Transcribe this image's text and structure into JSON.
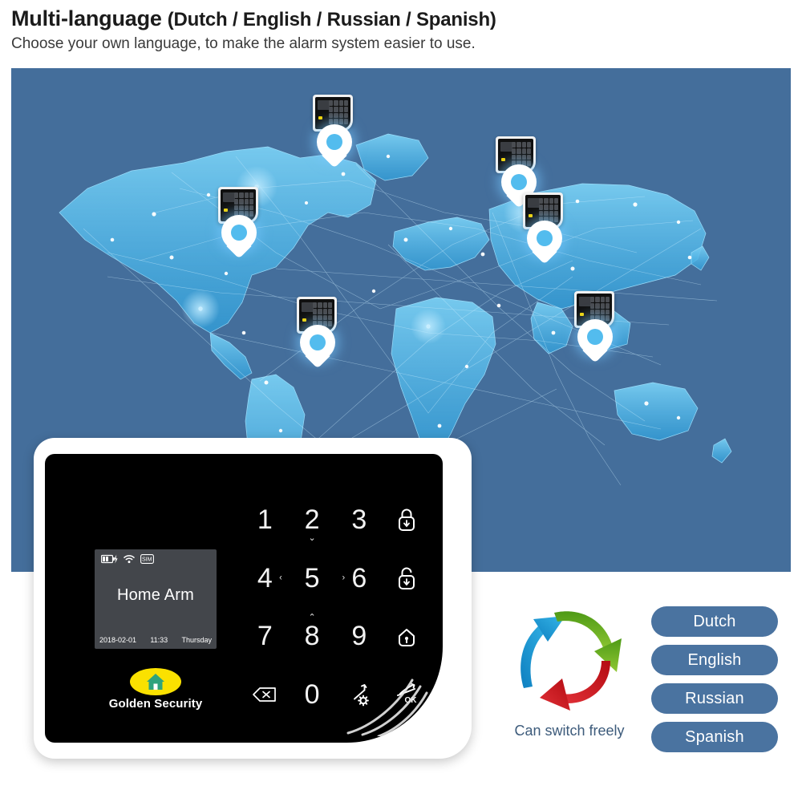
{
  "header": {
    "title_main": "Multi-language",
    "title_langs": "(Dutch / English / Russian / Spanish)",
    "subtitle": "Choose your own language, to make the alarm system easier to use."
  },
  "map": {
    "background_color": "#446E9B",
    "map_color": "#53BCEE",
    "pin_count": 6,
    "device_marker_count": 6
  },
  "device": {
    "lcd": {
      "main_text": "Home Arm",
      "date": "2018-02-01",
      "time": "11:33",
      "weekday": "Thursday",
      "status_icons": [
        "battery-charging-icon",
        "wifi-icon",
        "sim-icon"
      ]
    },
    "brand": {
      "name": "Golden Security",
      "badge_color": "#FAE100",
      "house_color": "#2FA37C"
    },
    "keypad": {
      "keys": [
        {
          "label": "1",
          "nav": "",
          "type": "digit"
        },
        {
          "label": "2",
          "nav": "v",
          "type": "digit"
        },
        {
          "label": "3",
          "nav": "",
          "type": "digit"
        },
        {
          "label": "",
          "nav": "",
          "type": "icon",
          "icon": "lock-closed-arm-icon"
        },
        {
          "label": "4",
          "nav": "<",
          "type": "digit"
        },
        {
          "label": "5",
          "nav": "",
          "type": "digit"
        },
        {
          "label": "6",
          "nav": ">",
          "type": "digit"
        },
        {
          "label": "",
          "nav": "",
          "type": "icon",
          "icon": "lock-open-disarm-icon"
        },
        {
          "label": "7",
          "nav": "",
          "type": "digit"
        },
        {
          "label": "8",
          "nav": "^",
          "type": "digit"
        },
        {
          "label": "9",
          "nav": "",
          "type": "digit"
        },
        {
          "label": "",
          "nav": "",
          "type": "icon",
          "icon": "home-arm-icon"
        },
        {
          "label": "",
          "nav": "",
          "type": "icon",
          "icon": "backspace-delete-icon"
        },
        {
          "label": "0",
          "nav": "",
          "type": "digit"
        },
        {
          "label": "",
          "nav": "",
          "type": "icon",
          "icon": "settings-gear-icon"
        },
        {
          "label": "",
          "nav": "",
          "type": "icon",
          "icon": "ok-confirm-icon"
        }
      ]
    }
  },
  "switch": {
    "caption": "Can switch freely",
    "arrow_colors": [
      "#1B9BD8",
      "#76B82A",
      "#D51317"
    ]
  },
  "languages": {
    "chip_color": "#4A73A0",
    "items": [
      {
        "label": "Dutch"
      },
      {
        "label": "English"
      },
      {
        "label": "Russian"
      },
      {
        "label": "Spanish"
      }
    ]
  }
}
